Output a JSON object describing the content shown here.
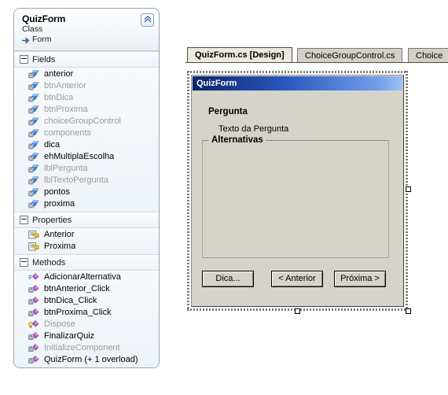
{
  "class_diagram": {
    "title": "QuizForm",
    "kind": "Class",
    "base": "Form",
    "collapse_icon": "chevron-double-up-icon",
    "sections": [
      {
        "name": "Fields",
        "label": "Fields",
        "icon": "field-icon",
        "members": [
          {
            "label": "anterior",
            "style": "normal"
          },
          {
            "label": "btnAnterior",
            "style": "dim"
          },
          {
            "label": "btnDica",
            "style": "dim"
          },
          {
            "label": "btnProxima",
            "style": "dim"
          },
          {
            "label": "choiceGroupControl",
            "style": "dim"
          },
          {
            "label": "components",
            "style": "dim"
          },
          {
            "label": "dica",
            "style": "normal"
          },
          {
            "label": "ehMultiplaEscolha",
            "style": "normal"
          },
          {
            "label": "lblPergunta",
            "style": "dim"
          },
          {
            "label": "lblTextoPergunta",
            "style": "dim"
          },
          {
            "label": "pontos",
            "style": "normal"
          },
          {
            "label": "proxima",
            "style": "normal"
          }
        ]
      },
      {
        "name": "Properties",
        "label": "Properties",
        "icon": "property-icon",
        "members": [
          {
            "label": "Anterior",
            "style": "normal"
          },
          {
            "label": "Proxima",
            "style": "normal"
          }
        ]
      },
      {
        "name": "Methods",
        "label": "Methods",
        "icon": "method-icon",
        "members": [
          {
            "label": "AdicionarAlternativa",
            "style": "normal",
            "icon": "method-protected-icon"
          },
          {
            "label": "btnAnterior_Click",
            "style": "normal",
            "icon": "method-icon"
          },
          {
            "label": "btnDica_Click",
            "style": "normal",
            "icon": "method-icon"
          },
          {
            "label": "btnProxima_Click",
            "style": "normal",
            "icon": "method-icon"
          },
          {
            "label": "Dispose",
            "style": "dim",
            "icon": "method-override-icon"
          },
          {
            "label": "FinalizarQuiz",
            "style": "normal",
            "icon": "method-icon"
          },
          {
            "label": "InitializeComponent",
            "style": "dim",
            "icon": "method-icon"
          },
          {
            "label": "QuizForm (+ 1 overload)",
            "style": "normal",
            "icon": "method-icon"
          }
        ]
      }
    ]
  },
  "editor": {
    "tabs": [
      {
        "label": "QuizForm.cs [Design]",
        "active": true
      },
      {
        "label": "ChoiceGroupControl.cs",
        "active": false
      },
      {
        "label": "Choice",
        "active": false
      }
    ]
  },
  "form_designer": {
    "window_title": "QuizForm",
    "label_pergunta": "Pergunta",
    "label_texto_pergunta": "Texto da Pergunta",
    "groupbox_title": "Alternativas",
    "buttons": [
      {
        "id": "btn-dica",
        "label": "Dica..."
      },
      {
        "id": "btn-anterior",
        "label": "< Anterior"
      },
      {
        "id": "btn-proxima",
        "label": "Próxima >"
      }
    ]
  },
  "colors": {
    "titlebar_start": "#0a246a",
    "titlebar_end": "#9dc0f2",
    "form_face": "#d6d3cb",
    "panel_border": "#9aa6b5",
    "field_icon": "#2f6fc0",
    "method_icon": "#b44fc8",
    "property_icon": "#e8c33a"
  }
}
